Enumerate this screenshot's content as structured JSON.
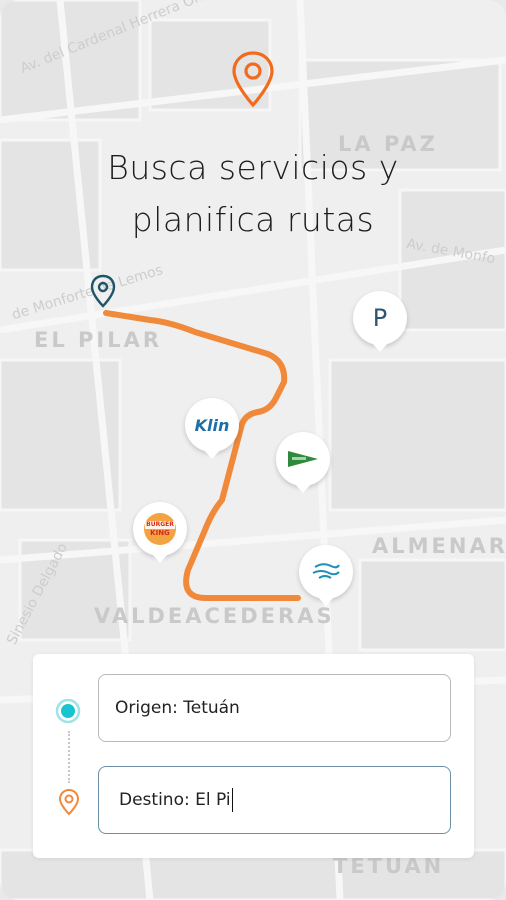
{
  "headline": {
    "line1": "Busca servicios y",
    "line2": "planifica rutas"
  },
  "map": {
    "districts": {
      "la_paz": "LA PAZ",
      "el_pilar": "EL PILAR",
      "almenar": "ALMENAR",
      "valdeacederas": "VALDEACEDERAS",
      "tetuan": "TETUAN"
    },
    "streets": {
      "cardenal": "Av. del Cardenal Herrera Oria",
      "monforte": "de Monforte de Lemos",
      "monforte_right": "Av. de Monfo",
      "sinesio": "Sinesio Delgado"
    },
    "pois": {
      "parking_label": "P",
      "klin_label": "Klin",
      "burger_king_line1": "BURGER",
      "burger_king_line2": "KING"
    },
    "route_color": "#f0893a"
  },
  "route_form": {
    "origin_value": "Origen: Tetuán",
    "destination_value": "Destino: El Pi"
  },
  "colors": {
    "accent": "#f26b1d",
    "origin_dot": "#17c4d0",
    "route": "#f0893a"
  }
}
